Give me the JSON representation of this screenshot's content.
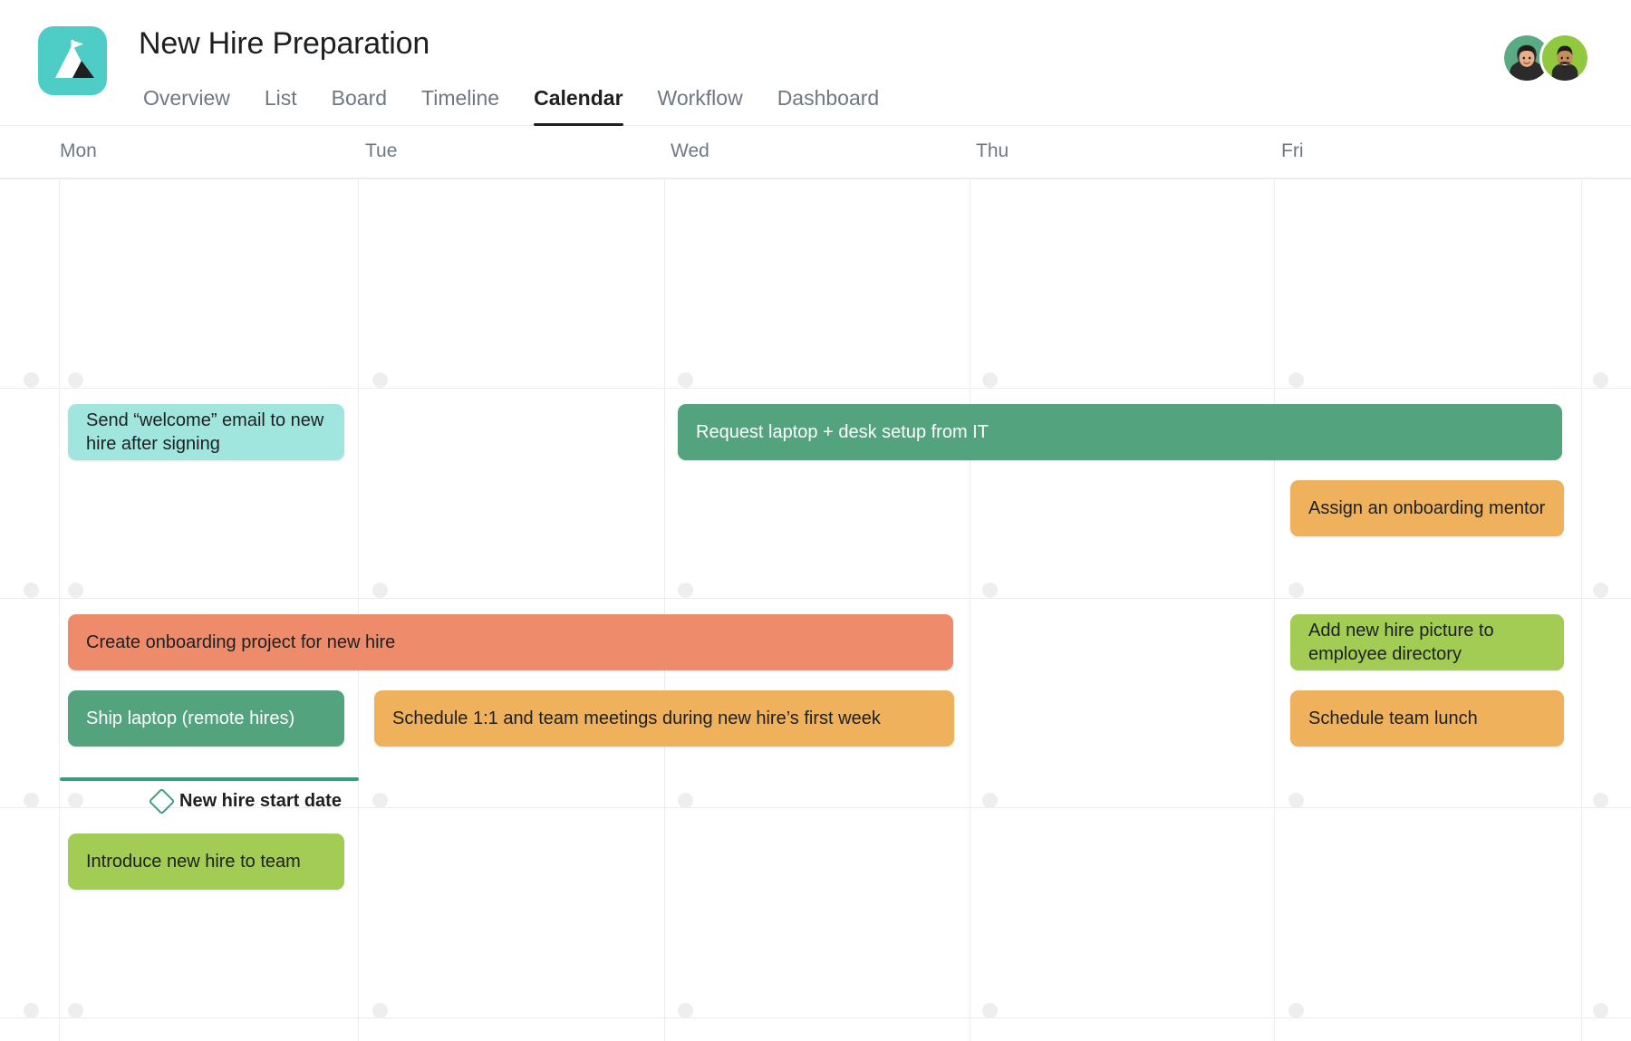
{
  "header": {
    "project_title": "New Hire Preparation",
    "logo_icon": "mountain-flag-icon",
    "tabs": [
      {
        "label": "Overview",
        "active": false
      },
      {
        "label": "List",
        "active": false
      },
      {
        "label": "Board",
        "active": false
      },
      {
        "label": "Timeline",
        "active": false
      },
      {
        "label": "Calendar",
        "active": true
      },
      {
        "label": "Workflow",
        "active": false
      },
      {
        "label": "Dashboard",
        "active": false
      }
    ],
    "avatars": [
      {
        "name": "member-avatar-1",
        "bg": "#5aab84"
      },
      {
        "name": "member-avatar-2",
        "bg": "#92c83e"
      }
    ]
  },
  "calendar": {
    "day_headers": [
      "Mon",
      "Tue",
      "Wed",
      "Thu",
      "Fri"
    ],
    "tasks": [
      {
        "id": "task-send-welcome-email",
        "title": "Send “welcome” email to new hire after signing",
        "color": "#a0e6de",
        "text_color": "#1e1f21"
      },
      {
        "id": "task-request-laptop-desk-setup",
        "title": "Request laptop + desk setup from IT",
        "color": "#53a37f",
        "text_color": "#ffffff"
      },
      {
        "id": "task-assign-onboarding-mentor",
        "title": "Assign an onboarding mentor",
        "color": "#efb15c",
        "text_color": "#1e1f21"
      },
      {
        "id": "task-create-onboarding-project",
        "title": "Create onboarding project for new hire",
        "color": "#ed8b6b",
        "text_color": "#1e1f21"
      },
      {
        "id": "task-ship-laptop",
        "title": "Ship laptop (remote hires)",
        "color": "#53a37f",
        "text_color": "#ffffff"
      },
      {
        "id": "task-schedule-meetings",
        "title": "Schedule 1:1 and team meetings during new hire’s first week",
        "color": "#efb15c",
        "text_color": "#1e1f21"
      },
      {
        "id": "task-add-picture-directory",
        "title": "Add new hire picture to employee directory",
        "color": "#a2cc53",
        "text_color": "#1e1f21"
      },
      {
        "id": "task-schedule-team-lunch",
        "title": "Schedule team lunch",
        "color": "#efb15c",
        "text_color": "#1e1f21"
      },
      {
        "id": "task-introduce-new-hire",
        "title": "Introduce new hire to team",
        "color": "#a2cc53",
        "text_color": "#1e1f21"
      }
    ],
    "milestone": {
      "label": "New hire start date",
      "icon": "diamond-milestone-icon",
      "color": "#3f9d7f"
    }
  }
}
